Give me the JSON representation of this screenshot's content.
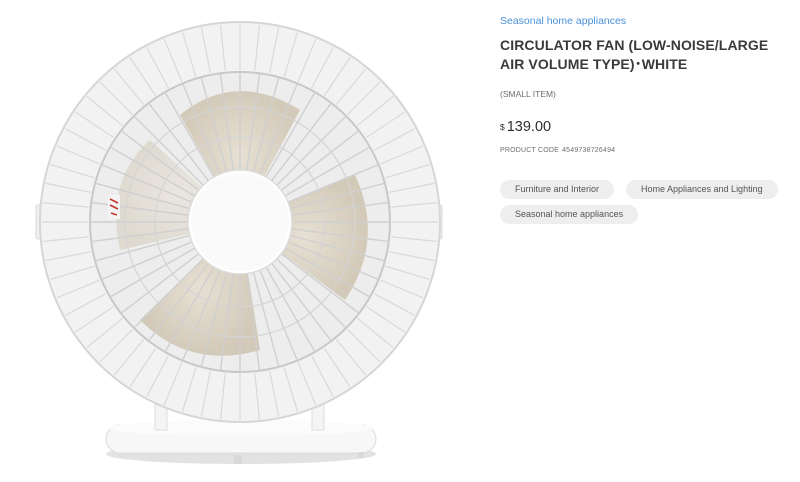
{
  "product": {
    "breadcrumb": "Seasonal home appliances",
    "title": "CIRCULATOR FAN (LOW-NOISE/LARGE AIR VOLUME TYPE)･WHITE",
    "size_note": "(SMALL ITEM)",
    "price_currency": "$",
    "price_amount": "139.00",
    "product_code_label": "PRODUCT CODE",
    "product_code": "4549738726494",
    "tags": [
      {
        "label": "Furniture and Interior"
      },
      {
        "label": "Home Appliances and Lighting"
      },
      {
        "label": "Seasonal home appliances"
      }
    ],
    "image": {
      "subject": "white circulator fan"
    }
  },
  "colors": {
    "link": "#4a90d9",
    "tag_bg": "#eeeeee",
    "text": "#3a3a3a"
  }
}
